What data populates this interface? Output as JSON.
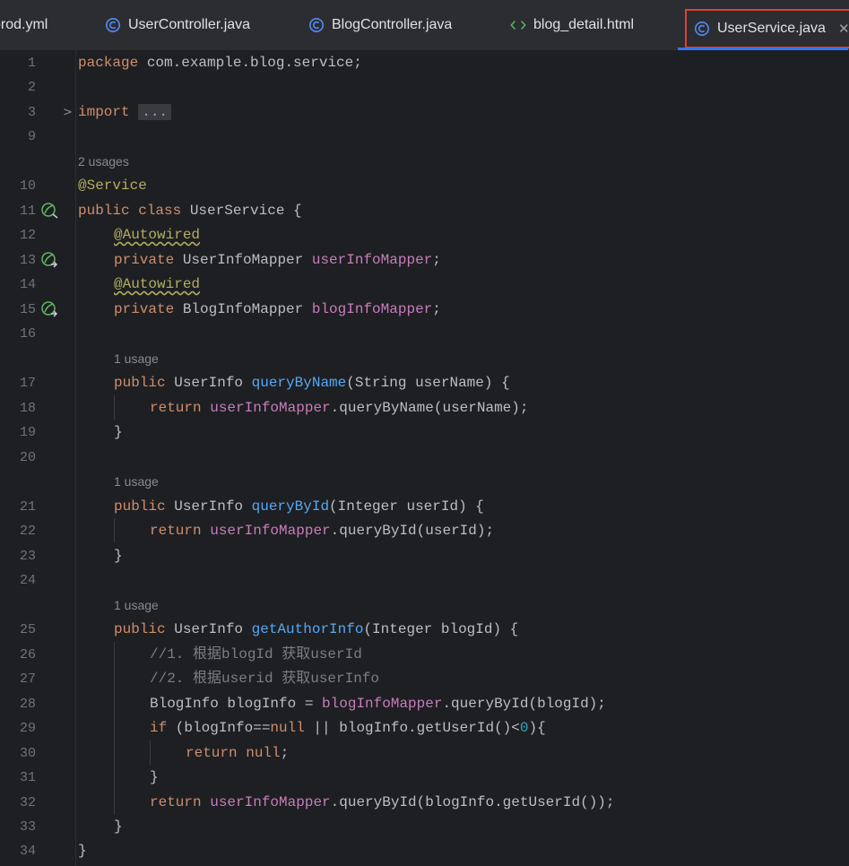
{
  "tabs": [
    {
      "label": "prod.yml",
      "icon": "yaml-file-icon"
    },
    {
      "label": "UserController.java",
      "icon": "java-class-icon"
    },
    {
      "label": "BlogController.java",
      "icon": "java-class-icon"
    },
    {
      "label": "blog_detail.html",
      "icon": "html-file-icon"
    },
    {
      "label": "UserService.java",
      "icon": "java-class-icon",
      "active": true
    }
  ],
  "tab_close_glyph": "✕",
  "colors": {
    "background": "#1e1f22",
    "keyword": "#cf8e6d",
    "annotation": "#b3ae60",
    "field": "#c77dbb",
    "method": "#56a8f5",
    "comment": "#7a7e85",
    "number": "#2aacb8",
    "active_tab_highlight": "#e0403c",
    "active_tab_underline": "#3574f0"
  },
  "editor": {
    "line_numbers": [
      "1",
      "2",
      "3",
      "9",
      "10",
      "11",
      "12",
      "13",
      "14",
      "15",
      "16",
      "17",
      "18",
      "19",
      "20",
      "21",
      "22",
      "23",
      "24",
      "25",
      "26",
      "27",
      "28",
      "29",
      "30",
      "31",
      "32",
      "33",
      "34"
    ],
    "usage_hints": {
      "class": "2 usages",
      "queryByName": "1 usage",
      "queryById": "1 usage",
      "getAuthorInfo": "1 usage"
    },
    "lines": {
      "l1_kw": "package",
      "l1_rest": " com.example.blog.service;",
      "l3_kw": "import",
      "l3_fold": "...",
      "l10_ann": "@Service",
      "l11_kw": "public class",
      "l11_rest": " UserService {",
      "l12_ann": "@Autowired",
      "l13_kw": "private",
      "l13_type": " UserInfoMapper ",
      "l13_fld": "userInfoMapper",
      "l13_end": ";",
      "l14_ann": "@Autowired",
      "l15_kw": "private",
      "l15_type": " BlogInfoMapper ",
      "l15_fld": "blogInfoMapper",
      "l15_end": ";",
      "l17_kw": "public",
      "l17_type": " UserInfo ",
      "l17_mth": "queryByName",
      "l17_rest": "(String userName) {",
      "l18_kw": "return",
      "l18_fld": "userInfoMapper",
      "l18_rest": ".queryByName(userName);",
      "l19": "}",
      "l21_kw": "public",
      "l21_type": " UserInfo ",
      "l21_mth": "queryById",
      "l21_rest": "(Integer userId) {",
      "l22_kw": "return",
      "l22_fld": "userInfoMapper",
      "l22_rest": ".queryById(userId);",
      "l23": "}",
      "l25_kw": "public",
      "l25_type": " UserInfo ",
      "l25_mth": "getAuthorInfo",
      "l25_rest": "(Integer blogId) {",
      "l26_cmt": "//1. 根据blogId 获取userId",
      "l27_cmt": "//2. 根据userid 获取userInfo",
      "l28_pre": "BlogInfo blogInfo = ",
      "l28_fld": "blogInfoMapper",
      "l28_rest": ".queryById(blogId);",
      "l29_kw": "if",
      "l29_a": " (blogInfo==",
      "l29_kw2": "null",
      "l29_b": " || blogInfo.getUserId()<",
      "l29_num": "0",
      "l29_c": "){",
      "l30_kw": "return",
      "l30_kw2": "null",
      "l30_end": ";",
      "l31": "}",
      "l32_kw": "return",
      "l32_fld": "userInfoMapper",
      "l32_rest": ".queryById(blogInfo.getUserId());",
      "l33": "}",
      "l34": "}"
    }
  }
}
